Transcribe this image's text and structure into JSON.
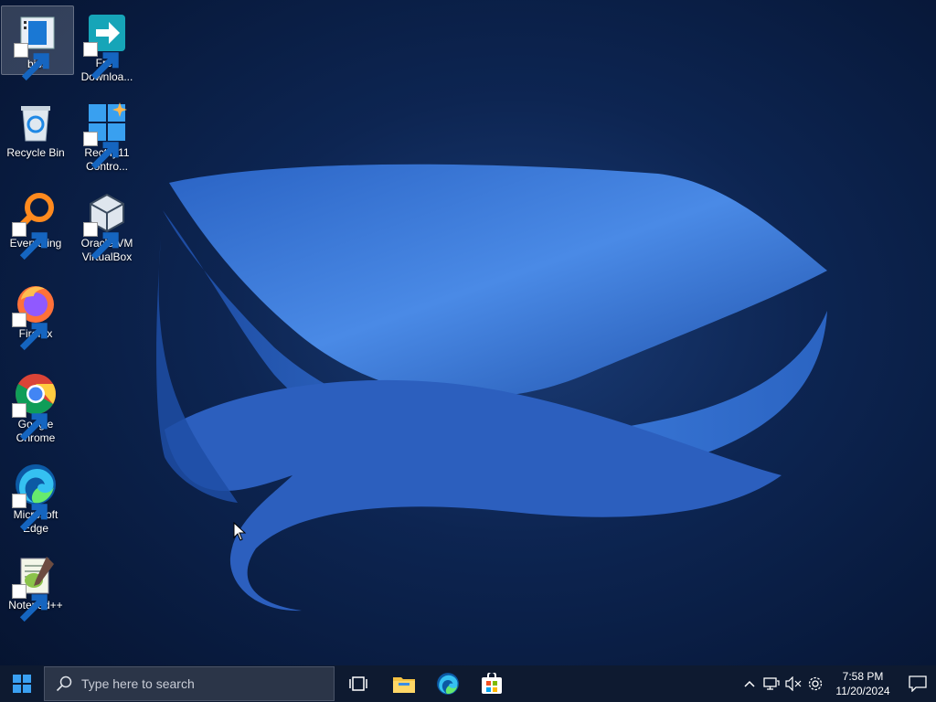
{
  "desktop": {
    "icons": [
      {
        "label": "bios"
      },
      {
        "label": "Free Downloa..."
      },
      {
        "label": "Recycle Bin"
      },
      {
        "label": "Rectify11 Contro..."
      },
      {
        "label": "Everything"
      },
      {
        "label": "Oracle VM VirtualBox"
      },
      {
        "label": "Firefox"
      },
      {
        "label": "Google Chrome"
      },
      {
        "label": "Microsoft Edge"
      },
      {
        "label": "Notepad++"
      }
    ]
  },
  "taskbar": {
    "search_placeholder": "Type here to search",
    "apps": [
      "start-icon",
      "task-view-icon",
      "file-explorer-icon",
      "edge-icon",
      "microsoft-store-icon"
    ],
    "tray": {
      "time": "7:58 PM",
      "date": "11/20/2024"
    }
  },
  "colors": {
    "taskbar": "#0e1a30",
    "wallpaper_bloom": "#3b7de0",
    "accent": "#0078d4"
  }
}
